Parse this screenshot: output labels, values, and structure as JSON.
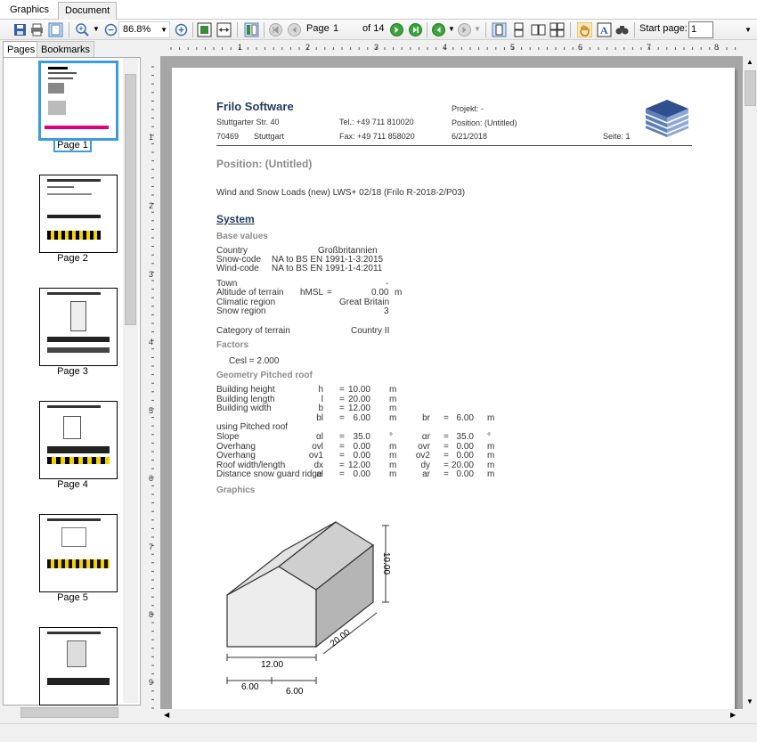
{
  "tabs": {
    "graphics": "Graphics",
    "document": "Document"
  },
  "toolbar": {
    "zoom": "86.8%",
    "page_label": "Page",
    "page_value": "1",
    "page_total": "of 14",
    "start_page_label": "Start page:",
    "start_page_value": "1"
  },
  "left_panel": {
    "tabs": {
      "pages": "Pages",
      "bookmarks": "Bookmarks"
    },
    "thumbnails": [
      "Page 1",
      "Page 2",
      "Page 3",
      "Page 4",
      "Page 5"
    ]
  },
  "ruler": {
    "h": [
      "1",
      "2",
      "3",
      "4",
      "5",
      "6",
      "7",
      "8"
    ],
    "v": [
      "1",
      "2",
      "3",
      "4",
      "5",
      "6",
      "7",
      "8",
      "9"
    ]
  },
  "document": {
    "company": "Frilo Software",
    "street": "Stuttgarter Str. 40",
    "zip": "70469",
    "city": "Stuttgart",
    "tel": "Tel.: +49 711 810020",
    "fax": "Fax: +49 711 858020",
    "projekt": "Projekt: -",
    "position_small": "Position: (Untitled)",
    "date": "6/21/2018",
    "seite": "Seite: 1",
    "position_title": "Position: (Untitled)",
    "program": "Wind and Snow Loads (new)  LWS+ 02/18 (Frilo R-2018-2/P03)",
    "system_heading": "System",
    "base_values": "Base values",
    "country_label": "Country",
    "country_value": "Großbritannien",
    "snow_code_label": "Snow-code",
    "snow_code_value": "NA to BS EN 1991-1-3:2015",
    "wind_code_label": "Wind-code",
    "wind_code_value": "NA to BS EN 1991-1-4:2011",
    "town_label": "Town",
    "town_value": "-",
    "altitude_label": "Altitude of terrain",
    "altitude_sym": "hMSL",
    "altitude_eq": "=",
    "altitude_value": "0.00",
    "altitude_unit": "m",
    "climatic_label": "Climatic region",
    "climatic_value": "Great Britain",
    "snowregion_label": "Snow region",
    "snowregion_value": "3",
    "terrain_label": "Category of terrain",
    "terrain_value": "Country II",
    "factors": "Factors",
    "cesl": "Cesl  =  2.000",
    "geometry": "Geometry Pitched roof",
    "rows": [
      {
        "label": "Building height",
        "s1": "h",
        "v1": "10.00",
        "u1": "m",
        "s2": "",
        "v2": "",
        "u2": ""
      },
      {
        "label": "Building length",
        "s1": "l",
        "v1": "20.00",
        "u1": "m",
        "s2": "",
        "v2": "",
        "u2": ""
      },
      {
        "label": "Building width",
        "s1": "b",
        "v1": "12.00",
        "u1": "m",
        "s2": "",
        "v2": "",
        "u2": ""
      },
      {
        "label": "",
        "s1": "bl",
        "v1": "6.00",
        "u1": "m",
        "s2": "br",
        "v2": "6.00",
        "u2": "m"
      },
      {
        "label": "using Pitched roof",
        "s1": "",
        "v1": "",
        "u1": "",
        "s2": "",
        "v2": "",
        "u2": ""
      },
      {
        "label": "Slope",
        "s1": "αl",
        "v1": "35.0",
        "u1": "°",
        "s2": "αr",
        "v2": "35.0",
        "u2": "°"
      },
      {
        "label": "Overhang",
        "s1": "ovl",
        "v1": "0.00",
        "u1": "m",
        "s2": "ovr",
        "v2": "0.00",
        "u2": "m"
      },
      {
        "label": "Overhang",
        "s1": "ov1",
        "v1": "0.00",
        "u1": "m",
        "s2": "ov2",
        "v2": "0.00",
        "u2": "m"
      },
      {
        "label": "Roof width/length",
        "s1": "dx",
        "v1": "12.00",
        "u1": "m",
        "s2": "dy",
        "v2": "20.00",
        "u2": "m"
      },
      {
        "label": "Distance snow guard ridge",
        "s1": "al",
        "v1": "0.00",
        "u1": "m",
        "s2": "ar",
        "v2": "0.00",
        "u2": "m"
      }
    ],
    "graphics_heading": "Graphics",
    "dims": {
      "height": "10.00",
      "width": "12.00",
      "length": "20.00",
      "half1": "6.00",
      "half2": "6.00"
    }
  }
}
